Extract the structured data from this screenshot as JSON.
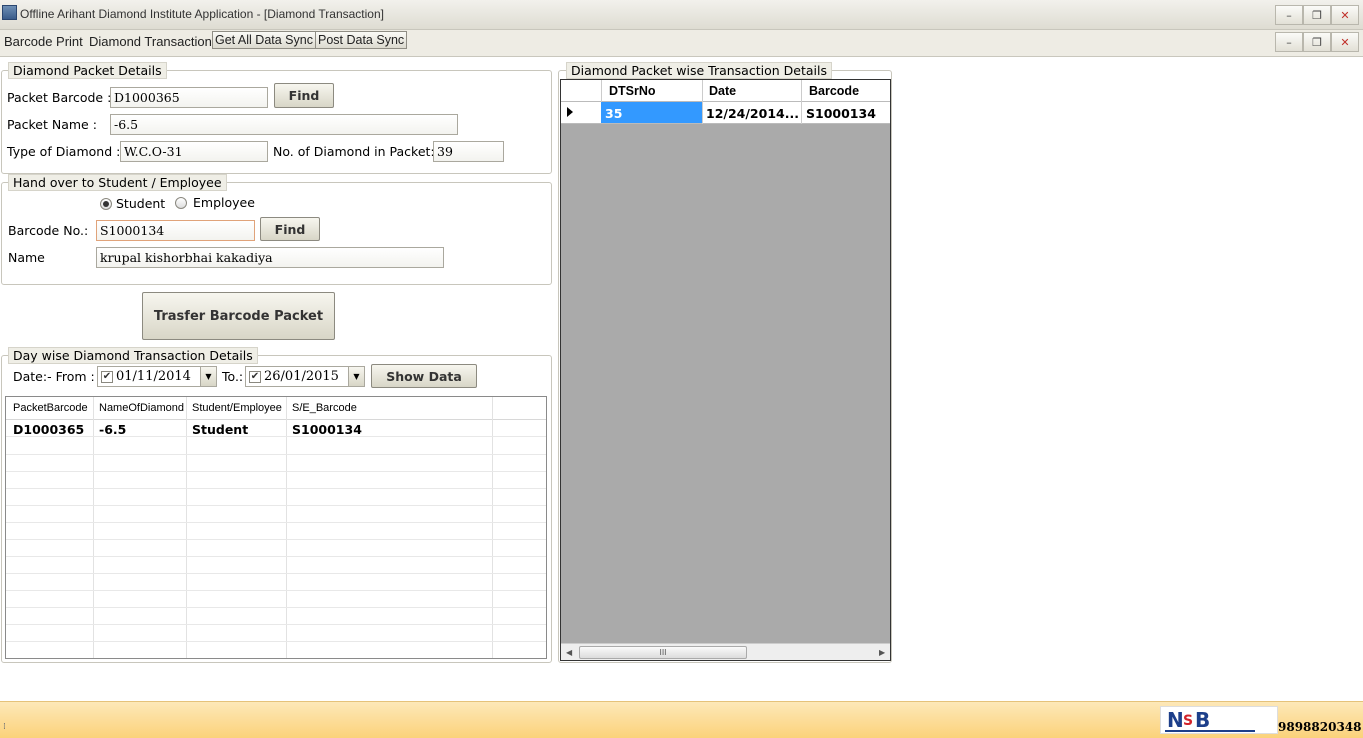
{
  "window": {
    "title": "Offline Arihant Diamond Institute Application - [Diamond Transaction]",
    "min": "–",
    "max": "❐",
    "close": "✕"
  },
  "menu": {
    "barcode_print": "Barcode Print",
    "diamond_transaction": "Diamond Transaction",
    "get_all_data_sync": "Get All Data Sync",
    "post_data_sync": "Post Data Sync"
  },
  "packet_details": {
    "legend": "Diamond Packet Details",
    "barcode_label": "Packet Barcode :",
    "barcode_value": "D1000365",
    "find": "Find",
    "name_label": "Packet Name :",
    "name_value": "-6.5",
    "type_label": "Type of Diamond :",
    "type_value": "W.C.O-31",
    "count_label": "No. of Diamond in Packet:",
    "count_value": "39"
  },
  "handover": {
    "legend": "Hand over to Student / Employee",
    "student": "Student",
    "employee": "Employee",
    "barcode_label": "Barcode No.:",
    "barcode_value": "S1000134",
    "find": "Find",
    "name_label": "Name",
    "name_value": "krupal kishorbhai kakadiya"
  },
  "transfer_button": "Trasfer Barcode Packet",
  "daywise": {
    "legend": "Day wise Diamond Transaction Details",
    "from_label": "Date:- From :",
    "from_value": "01/11/2014",
    "to_label": "To.:",
    "to_value": "26/01/2015",
    "show": "Show Data",
    "columns": [
      "PacketBarcode",
      "NameOfDiamond",
      "Student/Employee",
      "S/E_Barcode"
    ],
    "rows": [
      [
        "D1000365",
        "-6.5",
        "Student",
        "S1000134"
      ]
    ]
  },
  "packetwise": {
    "legend": "Diamond Packet wise Transaction Details",
    "columns": [
      "DTSrNo",
      "Date",
      "Barcode"
    ],
    "rows": [
      [
        "35",
        "12/24/2014...",
        "S1000134"
      ]
    ],
    "scroll_grip": "III"
  },
  "status": {
    "phone": "9898820348"
  }
}
